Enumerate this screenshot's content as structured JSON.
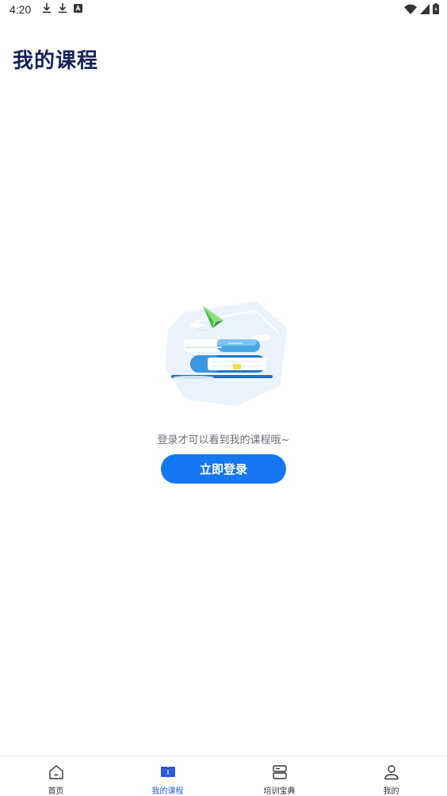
{
  "status_bar": {
    "time": "4:20",
    "icons": [
      "download-icon",
      "download-icon",
      "a-box-icon"
    ],
    "right_icons": [
      "wifi-icon",
      "signal-icon",
      "battery-icon"
    ]
  },
  "header": {
    "title": "我的课程"
  },
  "empty_state": {
    "illustration": "books-and-paper-plane-illustration",
    "message": "登录才可以看到我的课程哦~",
    "login_button_label": "立即登录"
  },
  "tab_bar": {
    "items": [
      {
        "label": "首页",
        "icon": "home-icon",
        "active": false
      },
      {
        "label": "我的课程",
        "icon": "book-icon",
        "active": true
      },
      {
        "label": "培训宝典",
        "icon": "stack-icon",
        "active": false
      },
      {
        "label": "我的",
        "icon": "person-icon",
        "active": false
      }
    ]
  },
  "colors": {
    "accent": "#1677f4",
    "title": "#172259",
    "active_tab": "#2d5bd6"
  }
}
